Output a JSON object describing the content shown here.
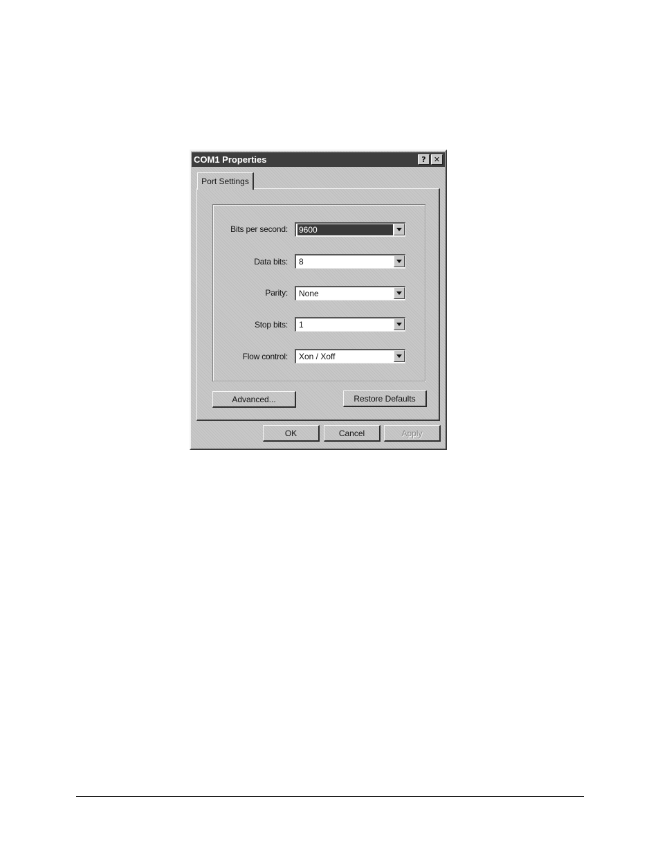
{
  "window": {
    "title": "COM1 Properties",
    "help_glyph": "?",
    "close_glyph": "✕"
  },
  "tabs": [
    {
      "label": "Port Settings",
      "active": true
    }
  ],
  "fields": [
    {
      "label": "Bits per second:",
      "value": "9600",
      "selected": true
    },
    {
      "label": "Data bits:",
      "value": "8",
      "selected": false
    },
    {
      "label": "Parity:",
      "value": "None",
      "selected": false
    },
    {
      "label": "Stop bits:",
      "value": "1",
      "selected": false
    },
    {
      "label": "Flow control:",
      "value": "Xon / Xoff",
      "selected": false
    }
  ],
  "panel_buttons": {
    "advanced": "Advanced...",
    "restore_defaults": "Restore Defaults"
  },
  "dialog_buttons": {
    "ok": "OK",
    "cancel": "Cancel",
    "apply": "Apply",
    "apply_enabled": false
  },
  "colors": {
    "dialog_face": "#c8c8c8",
    "title_bar": "#3e3e3e",
    "selection": "#3a3a3a"
  }
}
